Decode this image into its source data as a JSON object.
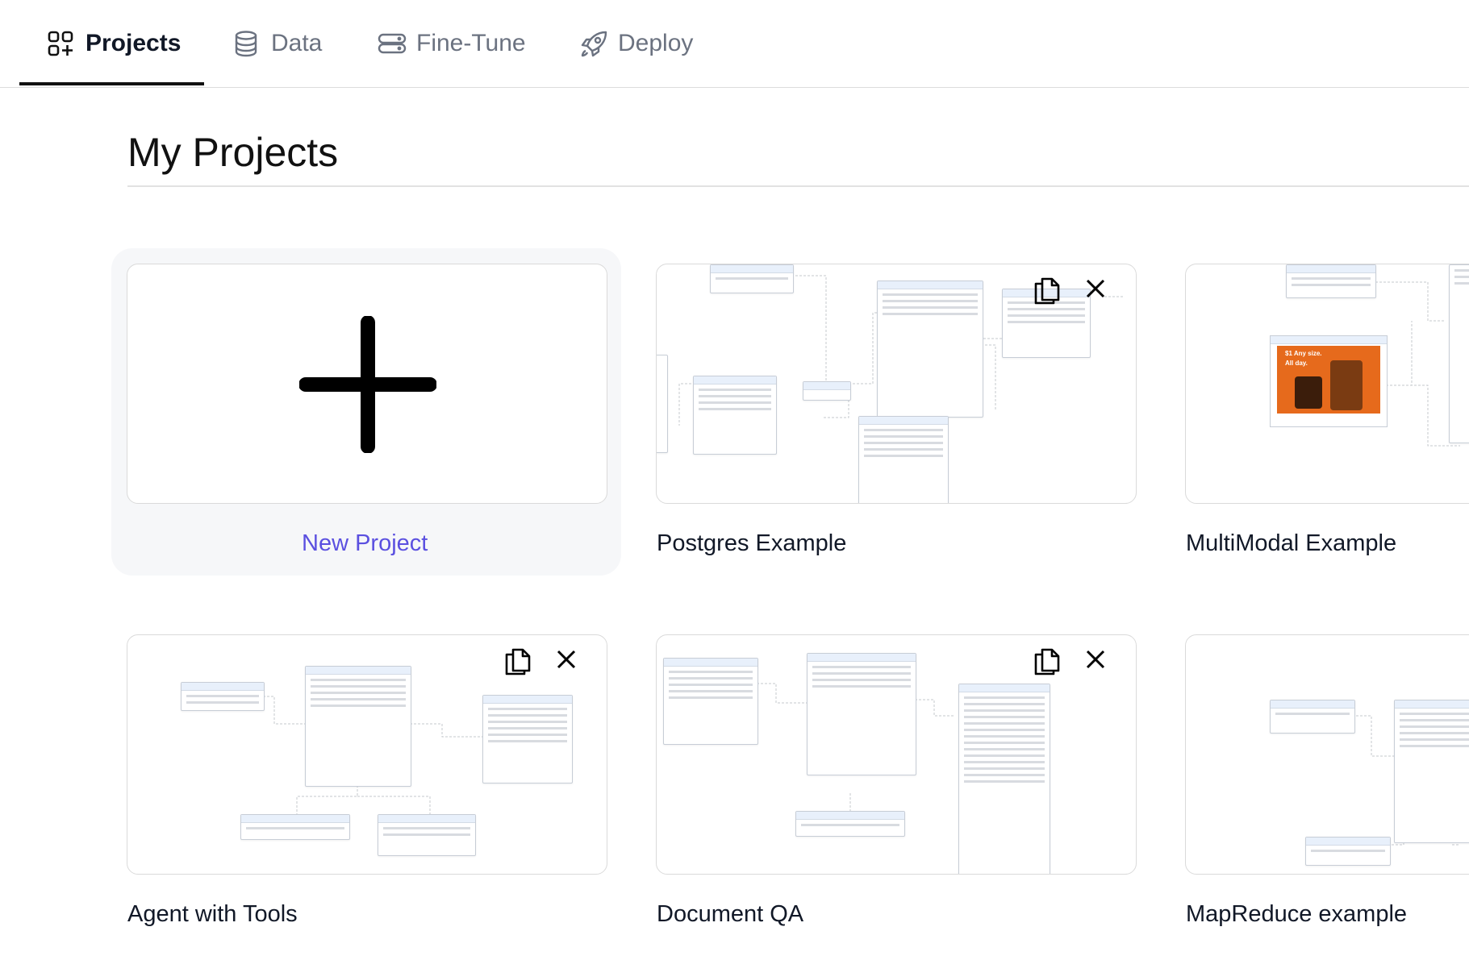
{
  "nav": {
    "tabs": [
      {
        "label": "Projects",
        "icon": "squares-plus-icon",
        "active": true
      },
      {
        "label": "Data",
        "icon": "database-icon",
        "active": false
      },
      {
        "label": "Fine-Tune",
        "icon": "server-stack-icon",
        "active": false
      },
      {
        "label": "Deploy",
        "icon": "rocket-icon",
        "active": false
      }
    ]
  },
  "page": {
    "title": "My Projects"
  },
  "new_project": {
    "label": "New Project",
    "icon": "plus-icon"
  },
  "projects": [
    {
      "label": "Postgres Example"
    },
    {
      "label": "MultiModal Example"
    },
    {
      "label": "Agent with Tools"
    },
    {
      "label": "Document QA"
    },
    {
      "label": "MapReduce example"
    }
  ],
  "card_actions": {
    "copy_icon": "copy-icon",
    "delete_icon": "close-icon"
  },
  "colors": {
    "accent": "#5b50e0",
    "active_tab": "#111827",
    "inactive_tab": "#6b7280"
  }
}
